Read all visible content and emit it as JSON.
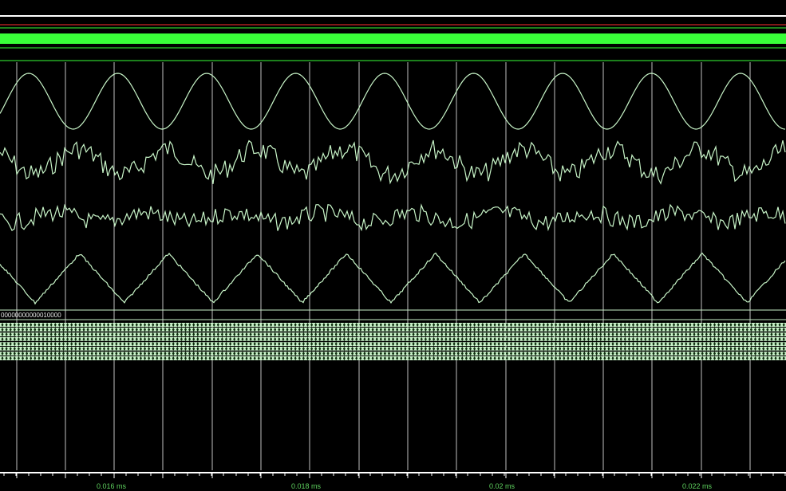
{
  "colors": {
    "background": "#000000",
    "grid": "#c8c8c8",
    "trace": "#c8f5c8",
    "digital_high": "#39ff39",
    "bus_fill": "#c8f0c8",
    "red_line": "#ff3030",
    "axis_text": "#5fd35f"
  },
  "bus": {
    "first_value": "00000000000010000"
  },
  "timeline": {
    "labels": [
      "0.016 ms",
      "0.018 ms",
      "0.02 ms",
      "0.022 ms"
    ]
  }
}
